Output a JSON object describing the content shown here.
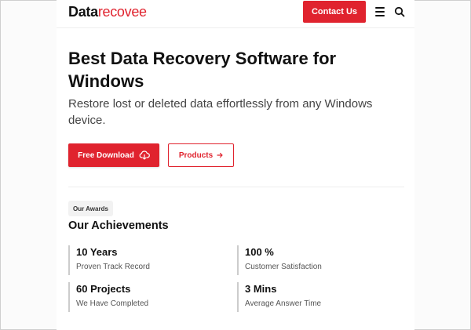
{
  "header": {
    "logo_dark": "Data",
    "logo_red": "recovee",
    "contact_label": "Contact Us",
    "menu_icon": "hamburger-menu-icon",
    "search_icon": "search-icon"
  },
  "hero": {
    "title": "Best Data Recovery Software for Windows",
    "subtitle": "Restore lost or deleted data effortlessly from any Windows device.",
    "download_label": "Free Download",
    "download_icon": "cloud-download-icon",
    "products_label": "Products",
    "products_icon": "arrow-right-icon"
  },
  "achievements": {
    "badge": "Our Awards",
    "title": "Our Achievements",
    "stats": [
      {
        "value": "10 Years",
        "label": "Proven Track Record"
      },
      {
        "value": "100 %",
        "label": "Customer Satisfaction"
      },
      {
        "value": "60 Projects",
        "label": "We Have Completed"
      },
      {
        "value": "3 Mins",
        "label": "Average Answer Time"
      }
    ]
  },
  "colors": {
    "brand_red": "#e0232e",
    "text": "#111111"
  }
}
